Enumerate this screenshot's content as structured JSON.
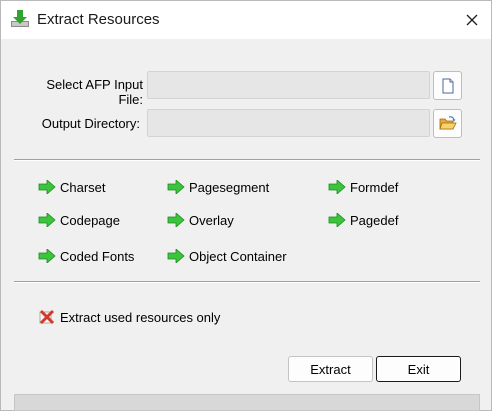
{
  "window": {
    "title": "Extract Resources"
  },
  "fields": {
    "input_label": "Select AFP Input File:",
    "input_value": "",
    "output_label": "Output Directory:",
    "output_value": ""
  },
  "resources": {
    "charset": "Charset",
    "codepage": "Codepage",
    "coded_fonts": "Coded Fonts",
    "pagesegment": "Pagesegment",
    "overlay": "Overlay",
    "object_container": "Object Container",
    "formdef": "Formdef",
    "pagedef": "Pagedef"
  },
  "options": {
    "used_only_label": "Extract used resources only",
    "used_only_checked": false
  },
  "buttons": {
    "extract": "Extract",
    "exit": "Exit"
  },
  "colors": {
    "arrow": "#3cc43c",
    "cross": "#d33a2c"
  }
}
